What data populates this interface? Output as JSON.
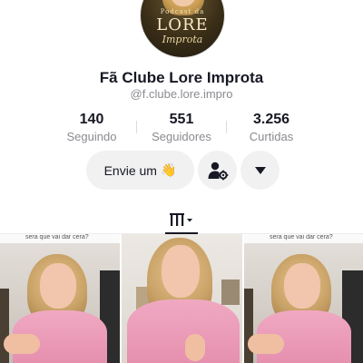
{
  "profile": {
    "avatar_text": {
      "script": "Podcast da",
      "name": "LORE",
      "sub": "Improta"
    },
    "display_name": "Fã Clube Lore Improta",
    "username": "@f.clube.lore.impro"
  },
  "stats": [
    {
      "value": "140",
      "label": "Seguindo"
    },
    {
      "value": "551",
      "label": "Seguidores"
    },
    {
      "value": "3.256",
      "label": "Curtidas"
    }
  ],
  "actions": {
    "message_label": "Envie um",
    "message_emoji": "👋",
    "add_friend_icon": "add-user-settings-icon",
    "more_icon": "caret-down-icon"
  },
  "tabs": {
    "active_icon": "grid-sort-icon"
  },
  "videos": [
    {
      "caption": "sera que vai dar cera?"
    },
    {
      "caption": ""
    },
    {
      "caption": "sera que vai dar cera?"
    }
  ],
  "colors": {
    "text_primary": "#161823",
    "text_secondary": "#8a8b91",
    "button_bg": "#f1f1f2",
    "shirt_pink": "#e58fae"
  }
}
